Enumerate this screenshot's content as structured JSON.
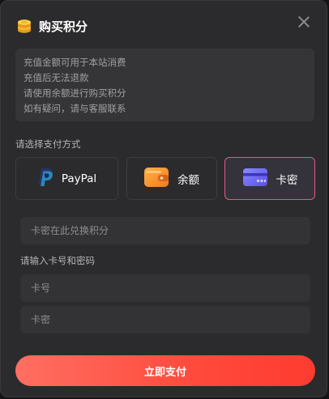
{
  "modal": {
    "title": "购买积分",
    "close_icon": "close-icon"
  },
  "notice": {
    "lines": [
      "充值金额可用于本站消费",
      "充值后无法退款",
      "请使用余额进行购买积分",
      "如有疑问，请与客服联系"
    ]
  },
  "payment": {
    "section_label": "请选择支付方式",
    "methods": [
      {
        "label": "PayPal",
        "icon": "paypal-icon",
        "selected": false
      },
      {
        "label": "余额",
        "icon": "wallet-icon",
        "selected": false
      },
      {
        "label": "卡密",
        "icon": "card-icon",
        "selected": true
      }
    ]
  },
  "redeem": {
    "placeholder": "卡密在此兑换积分",
    "label": "请输入卡号和密码",
    "card_number_placeholder": "卡号",
    "card_password_placeholder": "卡密"
  },
  "submit": {
    "label": "立即支付"
  },
  "colors": {
    "accent": "#ff4a3c",
    "selected_border": "#e05a8a",
    "background": "#2b2b2d"
  }
}
